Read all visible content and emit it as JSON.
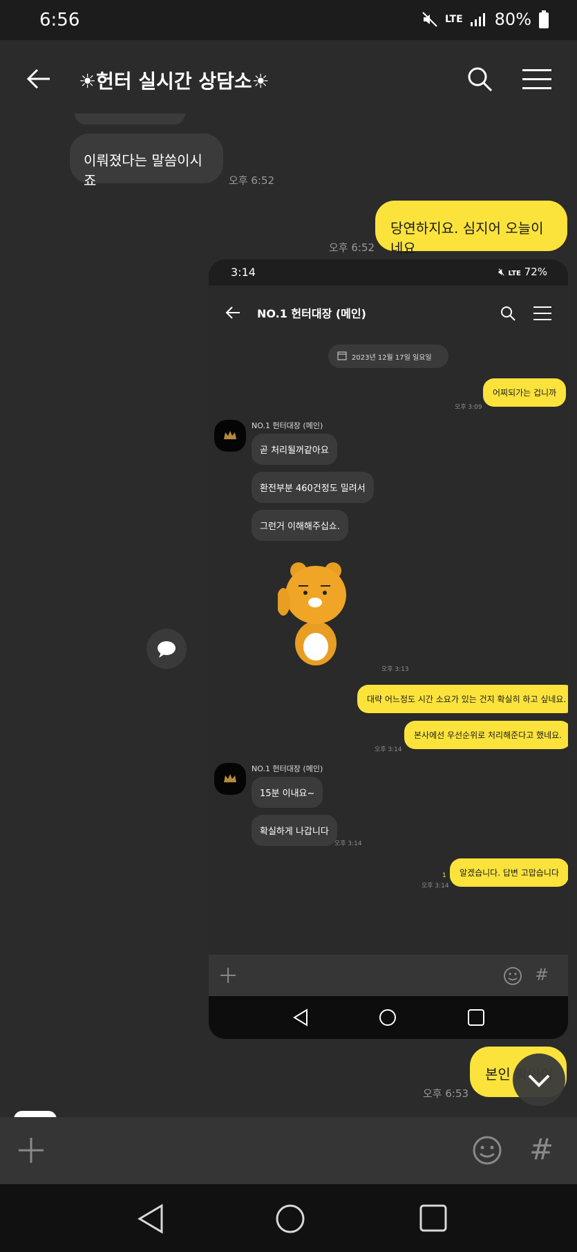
{
  "status": {
    "time": "6:56",
    "network": "LTE",
    "battery": "80%"
  },
  "header": {
    "title": "☀헌터 실시간 상담소☀"
  },
  "messages": [
    {
      "text": "이뤄졌다는 말씀이시죠",
      "time": "오후 6:52"
    },
    {
      "text": "당연하지요. 심지어 오늘이네요",
      "time": "오후 6:52"
    },
    {
      "text": "본인 확인이",
      "time": "오후 6:53"
    }
  ],
  "screenshot": {
    "status": {
      "time": "3:14",
      "network": "LTE",
      "battery": "72%"
    },
    "title": "NO.1 헌터대장 (메인)",
    "date": "2023년 12월 17일 일요일",
    "out1": {
      "text": "어찌되가는 겁니까",
      "time": "오후 3:09"
    },
    "sender": "NO.1 헌터대장 (메인)",
    "in1": [
      "곧 처리될꺼같아요",
      "환전부분 460건정도 밀려서",
      "그런거 이해해주십쇼."
    ],
    "sticker_time": "오후 3:13",
    "out2": [
      "대략 어느정도 시간 소요가 있는 건지 확실히 하고 싶네요.",
      "본사에선 우선순위로 처리해준다고 했네요."
    ],
    "out2_time": "오후 3:14",
    "in2": [
      "15분 이내요~",
      "확실하게 나갑니다"
    ],
    "in2_time": "오후 3:14",
    "out3": {
      "text": "알겠습니다. 답변 고맙습니다",
      "time": "오후 3:14",
      "unread": "1"
    }
  },
  "icons": {
    "back": "back-arrow-icon",
    "search": "search-icon",
    "menu": "menu-icon",
    "plus": "plus-icon",
    "emoji": "emoji-icon",
    "hash": "hash-icon",
    "scroll": "chevron-down-icon",
    "comment": "speech-bubble-icon"
  },
  "colors": {
    "yellow_bubble": "#fbe33c",
    "gray_bubble": "#3b3b3b",
    "background": "#2b2b2b"
  }
}
